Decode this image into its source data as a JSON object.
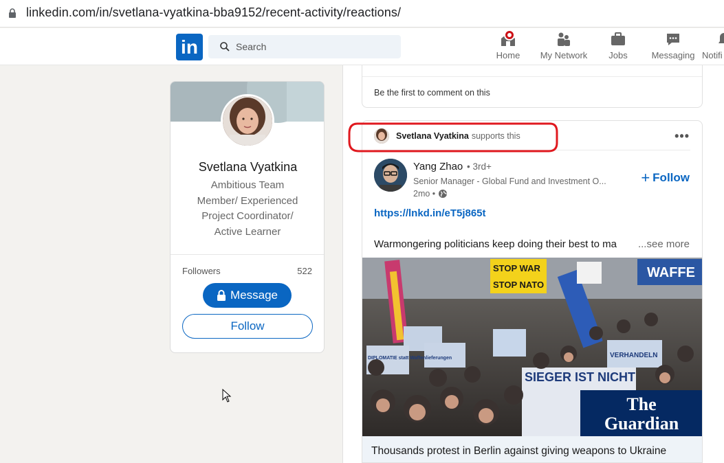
{
  "browser": {
    "url": "linkedin.com/in/svetlana-vyatkina-bba9152/recent-activity/reactions/"
  },
  "nav": {
    "logo": "in",
    "search_placeholder": "Search",
    "items": [
      {
        "label": "Home",
        "icon": "home-icon"
      },
      {
        "label": "My Network",
        "icon": "people-icon"
      },
      {
        "label": "Jobs",
        "icon": "briefcase-icon"
      },
      {
        "label": "Messaging",
        "icon": "chat-icon"
      },
      {
        "label": "Notifi",
        "icon": "bell-icon"
      }
    ]
  },
  "profile": {
    "name": "Svetlana Vyatkina",
    "headline": "Ambitious Team Member/ Experienced Project Coordinator/ Active Learner",
    "followers_label": "Followers",
    "followers_count": "522",
    "message_label": "Message",
    "follow_label": "Follow"
  },
  "previous_post": {
    "comment_prompt": "Be the first to comment on this"
  },
  "post": {
    "actor": "Svetlana Vyatkina",
    "action": "supports this",
    "author_name": "Yang Zhao",
    "author_degree": "• 3rd+",
    "author_headline": "Senior Manager - Global Fund and Investment O...",
    "time": "2mo •",
    "follow_label": "Follow",
    "link": "https://lnkd.in/eT5j865t",
    "text": "Warmongering politicians keep doing their best to ma",
    "see_more": "...see more",
    "image_signs": [
      "STOP WAR",
      "STOP NATO",
      "WAFFE",
      "VERHANDELN",
      "DIPLOMATIE statt Waffenlieferungen",
      "SIEGER IST NICHT"
    ],
    "image_watermark": "The Guardian",
    "caption": "Thousands protest in Berlin against giving weapons to Ukraine"
  },
  "colors": {
    "brand": "#0a66c2",
    "annotation": "#e0191f",
    "notification": "#cc1016"
  }
}
